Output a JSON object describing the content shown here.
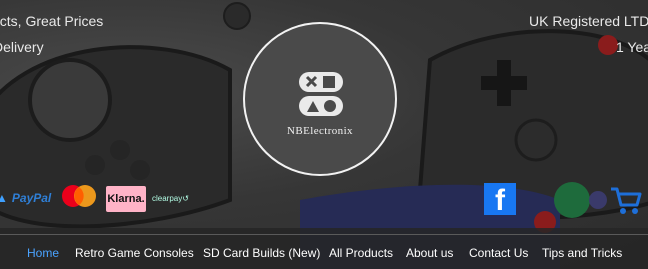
{
  "header": {
    "left_line_1": "ucts, Great Prices",
    "left_line_2": "Delivery",
    "right_line_1": "UK Registered LTD",
    "right_line_2": "1 Yea"
  },
  "logo": {
    "brand_name": "NBElectronix"
  },
  "payments": {
    "paypal_label": "PayPal",
    "klarna_label": "Klarna.",
    "clearpay_label": "clearpay"
  },
  "social": {
    "facebook_glyph": "f"
  },
  "nav": {
    "items": [
      {
        "label": "Home"
      },
      {
        "label": "Retro Game Consoles"
      },
      {
        "label": "SD Card Builds (New)"
      },
      {
        "label": "All Products"
      },
      {
        "label": "About us"
      },
      {
        "label": "Contact Us"
      },
      {
        "label": "Tips and Tricks"
      }
    ]
  },
  "colors": {
    "nav_active": "#4aa3ff",
    "facebook_blue": "#1877f2",
    "cart_blue": "#1e6fd9"
  }
}
